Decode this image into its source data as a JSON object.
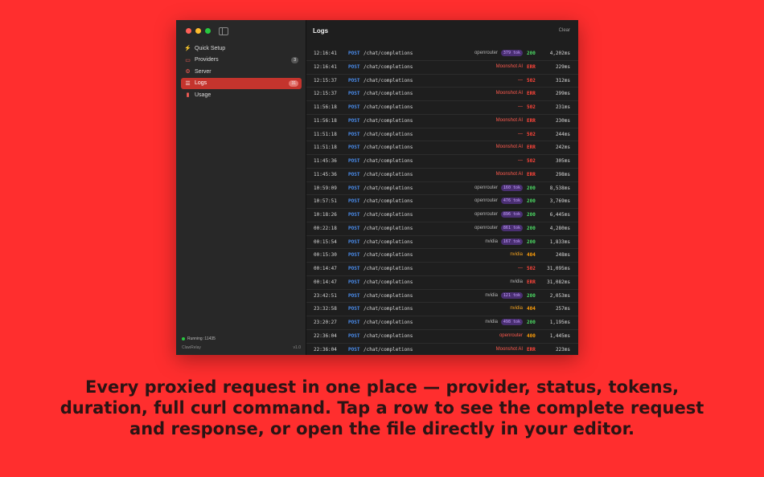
{
  "sidebar": {
    "items": [
      {
        "icon": "bolt-icon",
        "glyph": "⚡",
        "label": "Quick Setup",
        "badge": ""
      },
      {
        "icon": "server-rack-icon",
        "glyph": "▭",
        "label": "Providers",
        "badge": "3"
      },
      {
        "icon": "gear-icon",
        "glyph": "⚙",
        "label": "Server",
        "badge": ""
      },
      {
        "icon": "logs-icon",
        "glyph": "☰",
        "label": "Logs",
        "badge": "31"
      },
      {
        "icon": "bar-chart-icon",
        "glyph": "▮",
        "label": "Usage",
        "badge": ""
      }
    ],
    "status": "Running :11435",
    "app_name": "ClawRelay",
    "version": "v1.0"
  },
  "main": {
    "title": "Logs",
    "clear_label": "Clear"
  },
  "logs": [
    {
      "time": "12:16:41",
      "method": "POST",
      "path": "/chat/completions",
      "provider": "openrouter",
      "tokens": "379 tok",
      "code": "200",
      "duration": "4,202ms"
    },
    {
      "time": "12:16:41",
      "method": "POST",
      "path": "/chat/completions",
      "provider": "Moonshot AI",
      "tokens": "",
      "code": "ERR",
      "duration": "229ms"
    },
    {
      "time": "12:15:37",
      "method": "POST",
      "path": "/chat/completions",
      "provider": "—",
      "tokens": "",
      "code": "502",
      "duration": "312ms"
    },
    {
      "time": "12:15:37",
      "method": "POST",
      "path": "/chat/completions",
      "provider": "Moonshot AI",
      "tokens": "",
      "code": "ERR",
      "duration": "299ms"
    },
    {
      "time": "11:56:18",
      "method": "POST",
      "path": "/chat/completions",
      "provider": "—",
      "tokens": "",
      "code": "502",
      "duration": "231ms"
    },
    {
      "time": "11:56:18",
      "method": "POST",
      "path": "/chat/completions",
      "provider": "Moonshot AI",
      "tokens": "",
      "code": "ERR",
      "duration": "230ms"
    },
    {
      "time": "11:51:18",
      "method": "POST",
      "path": "/chat/completions",
      "provider": "—",
      "tokens": "",
      "code": "502",
      "duration": "244ms"
    },
    {
      "time": "11:51:18",
      "method": "POST",
      "path": "/chat/completions",
      "provider": "Moonshot AI",
      "tokens": "",
      "code": "ERR",
      "duration": "242ms"
    },
    {
      "time": "11:45:36",
      "method": "POST",
      "path": "/chat/completions",
      "provider": "—",
      "tokens": "",
      "code": "502",
      "duration": "305ms"
    },
    {
      "time": "11:45:36",
      "method": "POST",
      "path": "/chat/completions",
      "provider": "Moonshot AI",
      "tokens": "",
      "code": "ERR",
      "duration": "298ms"
    },
    {
      "time": "10:59:09",
      "method": "POST",
      "path": "/chat/completions",
      "provider": "openrouter",
      "tokens": "160 tok",
      "code": "200",
      "duration": "8,538ms"
    },
    {
      "time": "10:57:51",
      "method": "POST",
      "path": "/chat/completions",
      "provider": "openrouter",
      "tokens": "476 tok",
      "code": "200",
      "duration": "3,769ms"
    },
    {
      "time": "10:18:26",
      "method": "POST",
      "path": "/chat/completions",
      "provider": "openrouter",
      "tokens": "896 tok",
      "code": "200",
      "duration": "6,445ms"
    },
    {
      "time": "00:22:18",
      "method": "POST",
      "path": "/chat/completions",
      "provider": "openrouter",
      "tokens": "861 tok",
      "code": "200",
      "duration": "4,280ms"
    },
    {
      "time": "00:15:54",
      "method": "POST",
      "path": "/chat/completions",
      "provider": "nvidia",
      "tokens": "167 tok",
      "code": "200",
      "duration": "1,833ms"
    },
    {
      "time": "00:15:30",
      "method": "POST",
      "path": "/chat/completions",
      "provider": "nvidia",
      "tokens": "",
      "code": "404",
      "duration": "248ms"
    },
    {
      "time": "00:14:47",
      "method": "POST",
      "path": "/chat/completions",
      "provider": "—",
      "tokens": "",
      "code": "502",
      "duration": "31,095ms"
    },
    {
      "time": "00:14:47",
      "method": "POST",
      "path": "/chat/completions",
      "provider": "nvidia",
      "tokens": "",
      "code": "ERR",
      "duration": "31,082ms"
    },
    {
      "time": "23:42:51",
      "method": "POST",
      "path": "/chat/completions",
      "provider": "nvidia",
      "tokens": "121 tok",
      "code": "200",
      "duration": "2,053ms"
    },
    {
      "time": "23:32:58",
      "method": "POST",
      "path": "/chat/completions",
      "provider": "nvidia",
      "tokens": "",
      "code": "404",
      "duration": "257ms"
    },
    {
      "time": "23:20:27",
      "method": "POST",
      "path": "/chat/completions",
      "provider": "nvidia",
      "tokens": "498 tok",
      "code": "200",
      "duration": "1,195ms"
    },
    {
      "time": "22:36:04",
      "method": "POST",
      "path": "/chat/completions",
      "provider": "openrouter",
      "tokens": "",
      "code": "400",
      "duration": "1,445ms"
    },
    {
      "time": "22:36:04",
      "method": "POST",
      "path": "/chat/completions",
      "provider": "Moonshot AI",
      "tokens": "",
      "code": "ERR",
      "duration": "223ms"
    }
  ],
  "caption": "Every proxied request in one place — provider, status, tokens, duration, full curl command. Tap a row to see the complete request and response, or open the file directly in your editor.",
  "colors": {
    "background": "#ff2e2e",
    "accent": "#c4342d",
    "ok": "#4cd964",
    "error": "#ff453a",
    "warning": "#ff9f0a",
    "method": "#4a8ef0"
  }
}
